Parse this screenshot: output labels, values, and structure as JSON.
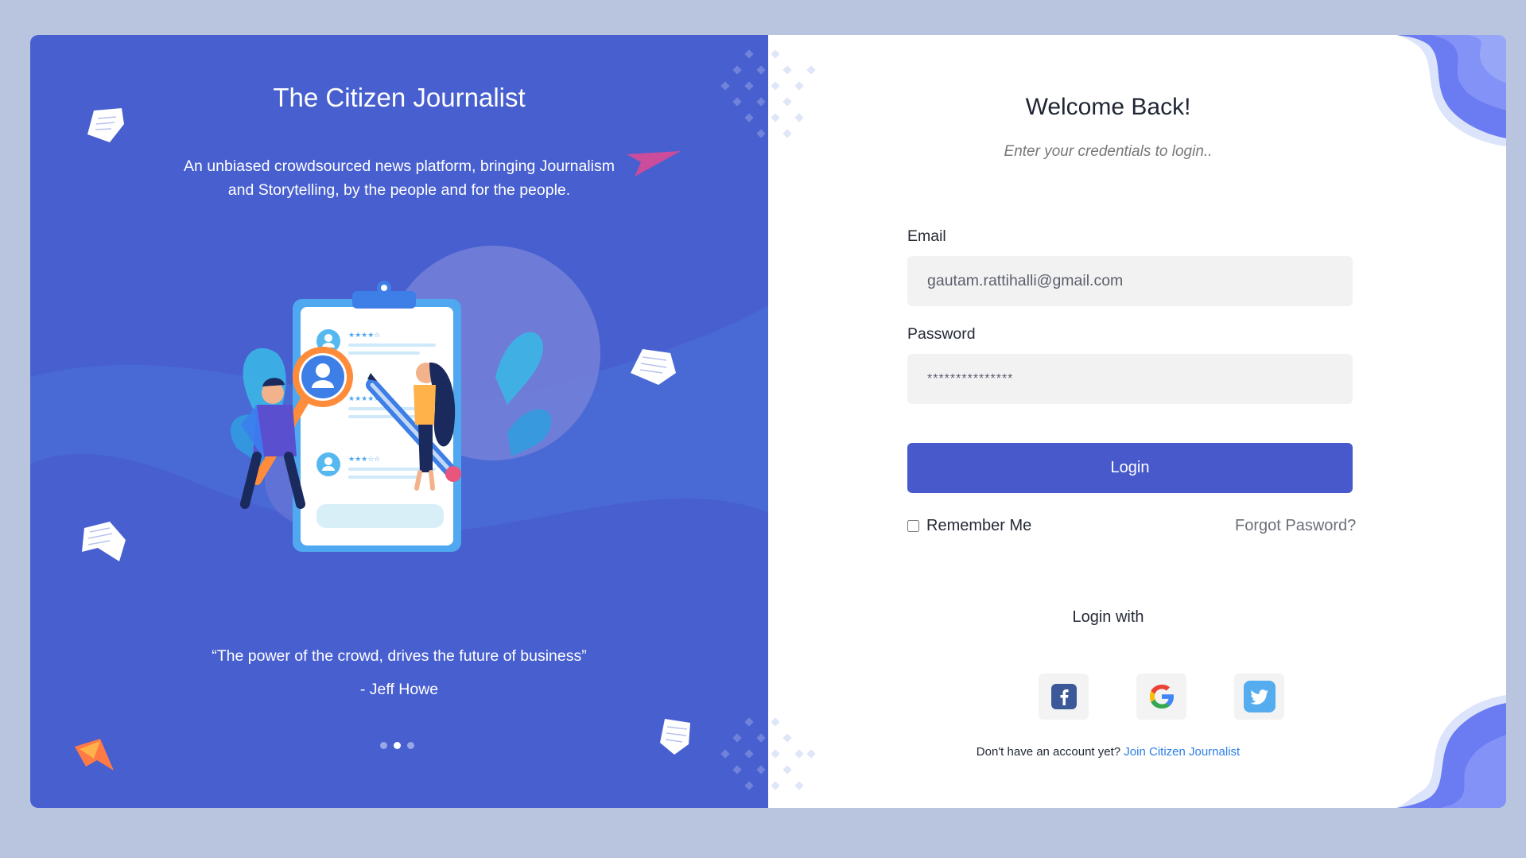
{
  "brand": {
    "title": "The Citizen Journalist",
    "tagline": "An unbiased crowdsourced news platform, bringing Journalism and Storytelling, by the people and for the people.",
    "quote": "“The power of the crowd, drives the future of business”",
    "author": "- Jeff Howe",
    "carousel_active_index": 1,
    "carousel_count": 3
  },
  "login": {
    "title": "Welcome Back!",
    "subtitle": "Enter your credentials to login..",
    "email_label": "Email",
    "email_value": "gautam.rattihalli@gmail.com",
    "password_label": "Password",
    "password_value": "***************",
    "login_button": "Login",
    "remember_label": "Remember Me",
    "remember_checked": false,
    "forgot_label": "Forgot Pasword?",
    "login_with": "Login with",
    "social_icons": [
      "facebook-icon",
      "google-icon",
      "twitter-icon"
    ],
    "signup_prompt": "Don't have an account yet?",
    "signup_link": "Join Citizen Journalist"
  },
  "colors": {
    "page_bg": "#b9c5de",
    "panel_blue": "#485fcf",
    "button_blue": "#485acb",
    "input_bg": "#f3f2f3",
    "link_blue": "#2d7ee6"
  }
}
